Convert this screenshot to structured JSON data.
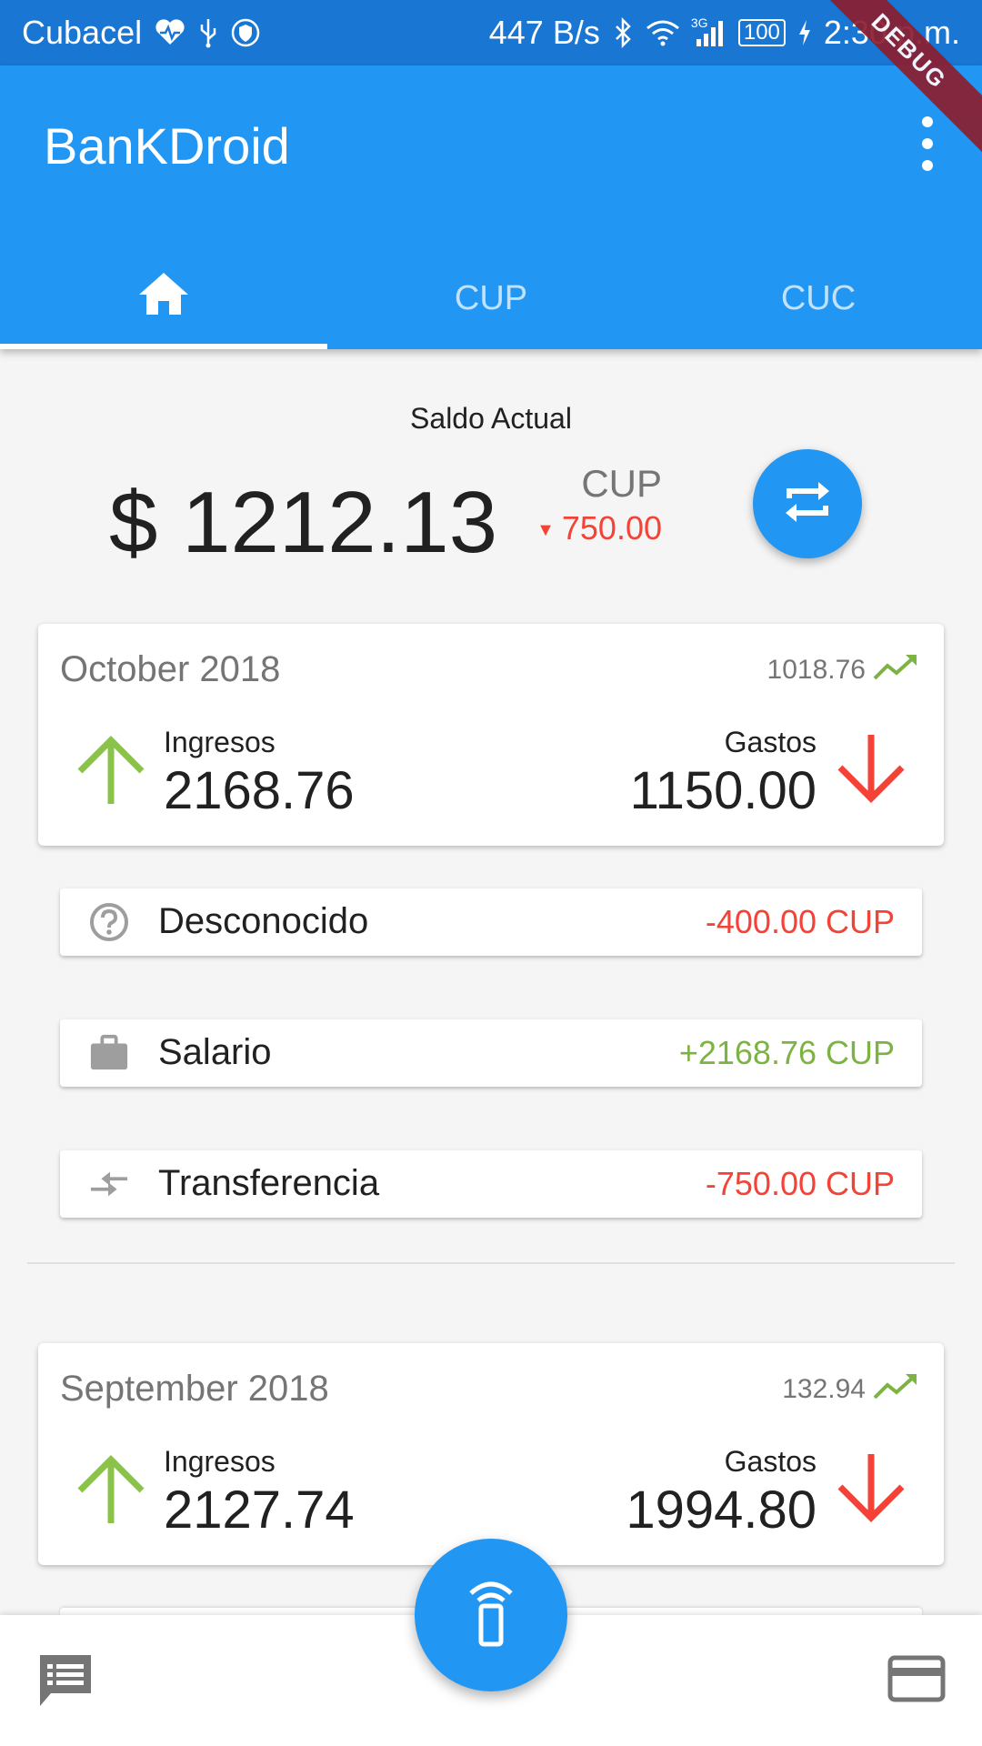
{
  "status_bar": {
    "carrier": "Cubacel",
    "net_speed": "447 B/s",
    "network_type": "3G",
    "battery": "100",
    "time": "2:30 p.m."
  },
  "debug_banner": "DEBUG",
  "app_bar": {
    "title": "BanKDroid",
    "tabs": [
      {
        "label": "",
        "icon": "home-icon",
        "active": true
      },
      {
        "label": "CUP",
        "active": false
      },
      {
        "label": "CUC",
        "active": false
      }
    ]
  },
  "balance": {
    "label": "Saldo Actual",
    "amount": "$ 1212.13",
    "currency": "CUP",
    "change": "750.00"
  },
  "months": [
    {
      "name": "October 2018",
      "delta": "1018.76",
      "income_label": "Ingresos",
      "income": "2168.76",
      "expense_label": "Gastos",
      "expense": "1150.00"
    },
    {
      "name": "September 2018",
      "delta": "132.94",
      "income_label": "Ingresos",
      "income": "2127.74",
      "expense_label": "Gastos",
      "expense": "1994.80"
    }
  ],
  "transactions": [
    {
      "label": "Desconocido",
      "amount": "-400.00 CUP",
      "icon": "help-circle-icon"
    },
    {
      "label": "Salario",
      "amount": "+2168.76 CUP",
      "icon": "briefcase-icon"
    },
    {
      "label": "Transferencia",
      "amount": "-750.00 CUP",
      "icon": "transfer-icon"
    }
  ],
  "colors": {
    "primary": "#2196f3",
    "status_bar": "#1976d2",
    "negative": "#f44336",
    "positive": "#7cb342",
    "debug": "#8b1e2f"
  }
}
